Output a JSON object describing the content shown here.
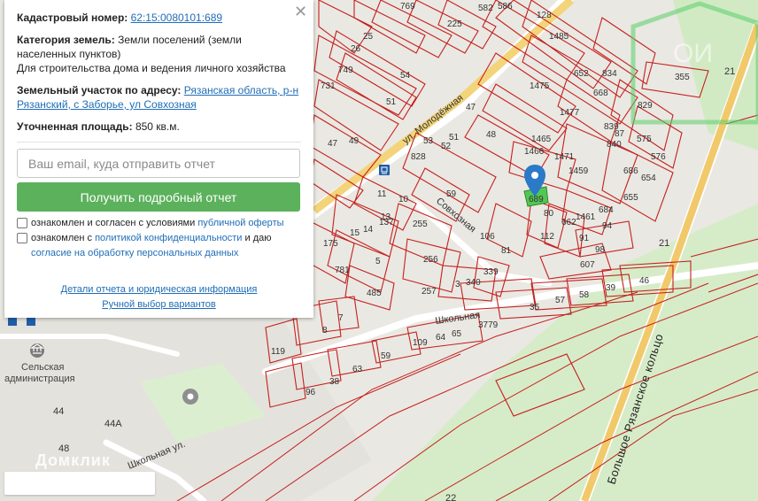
{
  "panel": {
    "cadastral_label": "Кадастровый номер:",
    "cadastral_value": "62:15:0080101:689",
    "category_label": "Категория земель:",
    "category_value_1": "Земли поселений (земли",
    "category_value_2": "населенных пунктов)",
    "purpose": "Для строительства дома и ведения личного хозяйства",
    "address_label": "Земельный участок по адресу:",
    "address_value_1": "Рязанская область, р-н",
    "address_value_2": "Рязанский, с Заборье, ул Совхозная",
    "area_label": "Уточненная площадь:",
    "area_value": "850 кв.м.",
    "close_icon": "close-icon"
  },
  "form": {
    "email_placeholder": "Ваш email, куда отправить отчет",
    "submit_label": "Получить подробный отчет",
    "consent1_text": "ознакомлен и согласен с условиями",
    "consent1_link": "публичной оферты",
    "consent2_text_a": "ознакомлен с",
    "consent2_link_a": "политикой конфиденциальности",
    "consent2_text_b": "и даю",
    "consent2_link_b": "согласие на обработку персональных данных"
  },
  "links": {
    "details": "Детали отчета и юридическая информация",
    "manual": "Ручной выбор вариантов"
  },
  "map": {
    "streets": {
      "ul_molodezhnaya": "ул. Молодёжная",
      "sovkhoznaya": "Совхозная",
      "shkolnaya_top": "Школьная",
      "shkolnaya_ul": "Школьная ул.",
      "ring_road": "Большое Рязанское кольцо"
    },
    "poi": {
      "admin_line1": "Сельская",
      "admin_line2": "администрация"
    },
    "house_numbers": [
      "44",
      "44А",
      "48",
      "21",
      "21",
      "22"
    ],
    "plots": [
      "769",
      "225",
      "582",
      "586",
      "128",
      "1485",
      "1475",
      "1477",
      "1465",
      "1466",
      "1471",
      "1459",
      "652",
      "834",
      "668",
      "829",
      "655",
      "654",
      "686",
      "87",
      "840",
      "839",
      "576",
      "575",
      "57",
      "355",
      "25",
      "26",
      "749",
      "731",
      "47",
      "49",
      "51",
      "54",
      "53",
      "51",
      "52",
      "53",
      "47",
      "48",
      "828",
      "59",
      "10",
      "11",
      "13",
      "15",
      "14",
      "137",
      "175",
      "255",
      "256",
      "257",
      "106",
      "81",
      "80",
      "662",
      "1461",
      "684",
      "112",
      "91",
      "94",
      "98",
      "607",
      "46",
      "39",
      "58",
      "57",
      "35",
      "339",
      "340",
      "3",
      "3779",
      "65",
      "64",
      "109",
      "59",
      "63",
      "38",
      "96",
      "485",
      "5",
      "781",
      "7",
      "8",
      "119"
    ],
    "selected_plot": "689",
    "marker_icon": "map-pin-icon",
    "bus_icon": "bus-stop-icon",
    "admin_icon": "government-building-icon",
    "watermark": "Домклик",
    "accent_green": "#5cb15c",
    "cadastre_red": "#c4201f",
    "link_blue": "#1f6db7",
    "marker_blue": "#2a7ac8"
  }
}
